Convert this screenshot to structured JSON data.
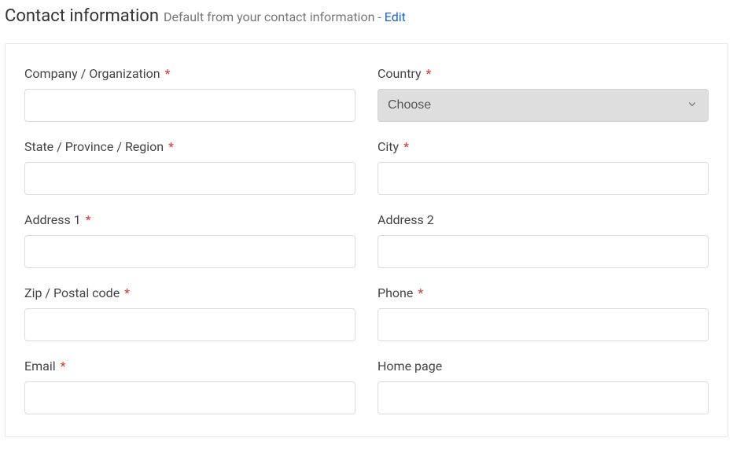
{
  "header": {
    "title": "Contact information",
    "subtitle": "Default from your contact information",
    "separator": " - ",
    "edit_label": "Edit"
  },
  "form": {
    "required_marker": "*",
    "company": {
      "label": "Company / Organization",
      "value": ""
    },
    "country": {
      "label": "Country",
      "placeholder": "Choose",
      "value": ""
    },
    "state": {
      "label": "State / Province / Region",
      "value": ""
    },
    "city": {
      "label": "City",
      "value": ""
    },
    "address1": {
      "label": "Address 1",
      "value": ""
    },
    "address2": {
      "label": "Address 2",
      "value": ""
    },
    "zip": {
      "label": "Zip / Postal code",
      "value": ""
    },
    "phone": {
      "label": "Phone",
      "value": ""
    },
    "email": {
      "label": "Email",
      "value": ""
    },
    "homepage": {
      "label": "Home page",
      "value": ""
    }
  }
}
